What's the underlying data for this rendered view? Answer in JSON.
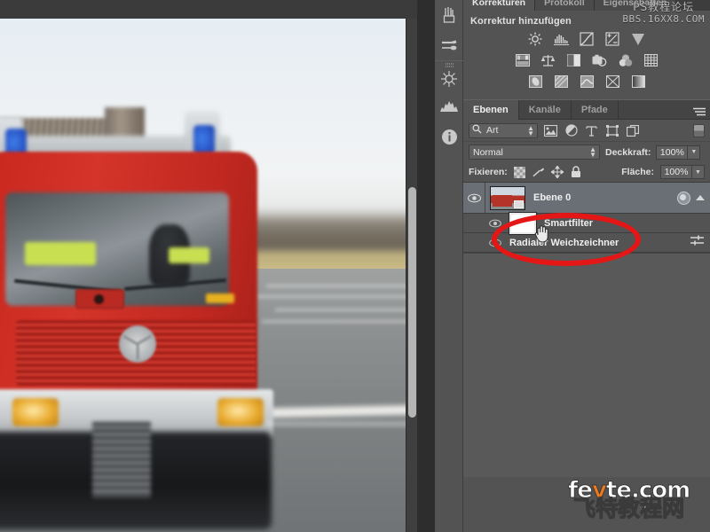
{
  "app": {
    "name": "Adobe Photoshop",
    "locale": "de"
  },
  "dock": {
    "items": [
      {
        "name": "brush-presets-icon",
        "glyph": "brush"
      },
      {
        "name": "brush-icon",
        "glyph": "brushes"
      },
      {
        "name": "history-icon",
        "glyph": "snowflake"
      },
      {
        "name": "histogram-icon",
        "glyph": "histogram"
      },
      {
        "name": "info-icon",
        "glyph": "info"
      }
    ]
  },
  "adjustments_panel": {
    "tabs": [
      {
        "label": "Korrekturen",
        "active": true
      },
      {
        "label": "Protokoll",
        "active": false
      },
      {
        "label": "Eigenschaften",
        "active": false
      }
    ],
    "title": "Korrektur hinzufügen",
    "rows": [
      [
        "brightness-contrast-icon",
        "levels-icon",
        "curves-icon",
        "exposure-icon",
        "vibrance-icon"
      ],
      [
        "hue-saturation-icon",
        "color-balance-icon",
        "black-white-icon",
        "photo-filter-icon",
        "channel-mixer-icon",
        "color-lookup-icon"
      ],
      [
        "invert-icon",
        "posterize-icon",
        "threshold-icon",
        "gradient-map-icon",
        "selective-color-icon"
      ]
    ]
  },
  "layers_panel": {
    "tabs": [
      {
        "label": "Ebenen",
        "active": true
      },
      {
        "label": "Kanäle",
        "active": false
      },
      {
        "label": "Pfade",
        "active": false
      }
    ],
    "menu_icon": "panel-menu-icon",
    "filter": {
      "kind_label": "Art",
      "search_icon": "search-icon",
      "type_filters": [
        "pixel-layer-icon",
        "adjustment-layer-icon",
        "type-layer-icon",
        "shape-layer-icon",
        "smart-object-icon"
      ],
      "toggle": "filter-enable-toggle"
    },
    "blend_mode": "Normal",
    "opacity_label": "Deckkraft:",
    "opacity_value": "100%",
    "lock_label": "Fixieren:",
    "lock_icons": [
      "lock-transparency-icon",
      "lock-image-icon",
      "lock-position-icon",
      "lock-all-icon"
    ],
    "fill_label": "Fläche:",
    "fill_value": "100%",
    "layers": [
      {
        "name": "Ebene 0",
        "selected": true,
        "visible": true,
        "type": "smart-object",
        "badge": "smart-object-badge",
        "expanded": true
      },
      {
        "name": "Smartfilter",
        "selected": false,
        "visible": true,
        "type": "smart-filter-mask",
        "indent": 1
      },
      {
        "name": "Radialer Weichzeichner",
        "selected": false,
        "visible": true,
        "type": "smart-filter-entry",
        "indent": 1,
        "options_icon": "filter-blending-options-icon"
      }
    ]
  },
  "annotation": {
    "shape": "ellipse",
    "color": "#e41616",
    "target": "Smartfilter / Radialer Weichzeichner"
  },
  "cursor": {
    "type": "hand-cursor"
  },
  "document": {
    "subject": "motion-blurred red Mercedes fire truck on a road",
    "scrollbar": "vertical-scrollbar"
  },
  "watermarks": {
    "top": {
      "line1": "PS教程论坛",
      "line2": "BBS.16XX8.COM"
    },
    "bottom": {
      "line1_a": "fe",
      "line1_b": "v",
      "line1_c": "te.com",
      "line2": "飞特教程网"
    }
  },
  "colors": {
    "panel_bg": "#535353",
    "panel_dark": "#3d3d3d",
    "selected_row": "#6a6f76",
    "annotation_red": "#e41616",
    "accent_orange": "#f07a1a"
  }
}
